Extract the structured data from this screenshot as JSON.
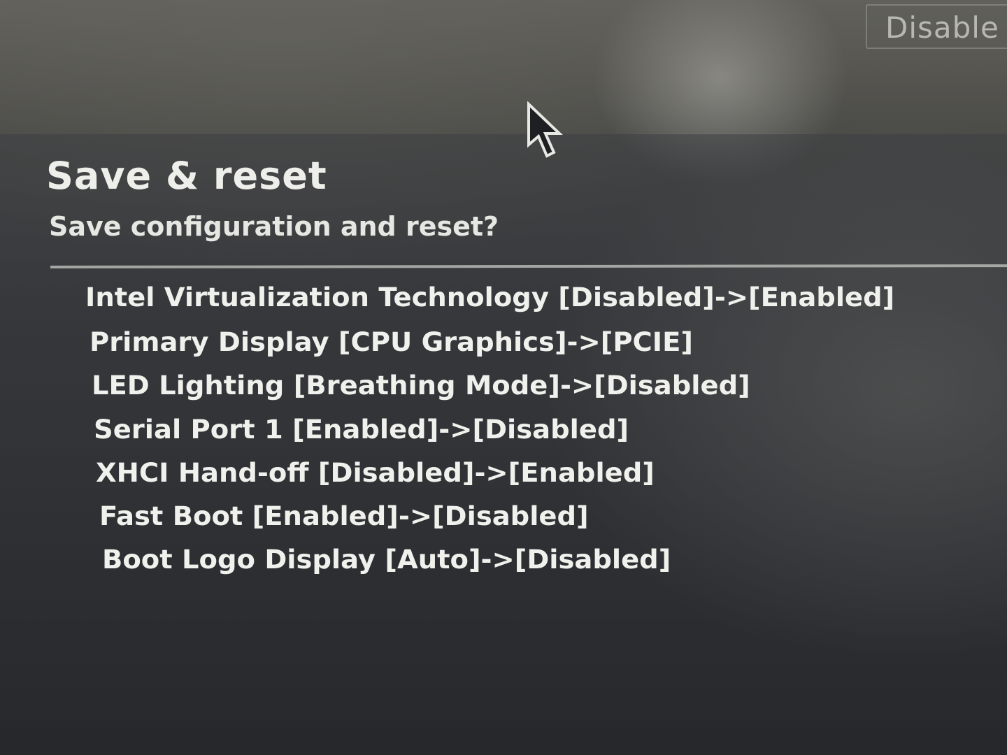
{
  "header": {
    "option_value_button": "Disable"
  },
  "dialog": {
    "title": "Save & reset",
    "question": "Save configuration and reset?",
    "changes": [
      "Intel Virtualization Technology [Disabled]->[Enabled]",
      "Primary Display [CPU Graphics]->[PCIE]",
      "LED Lighting [Breathing Mode]->[Disabled]",
      "Serial Port 1 [Enabled]->[Disabled]",
      "XHCI Hand-off [Disabled]->[Enabled]",
      "Fast Boot [Enabled]->[Disabled]",
      "Boot Logo Display [Auto]->[Disabled]"
    ]
  },
  "icons": {
    "cursor": "mouse-pointer-icon"
  },
  "colors": {
    "text": "#f0f0ec",
    "background": "#2b2d31",
    "divider": "#c8c8c4"
  }
}
